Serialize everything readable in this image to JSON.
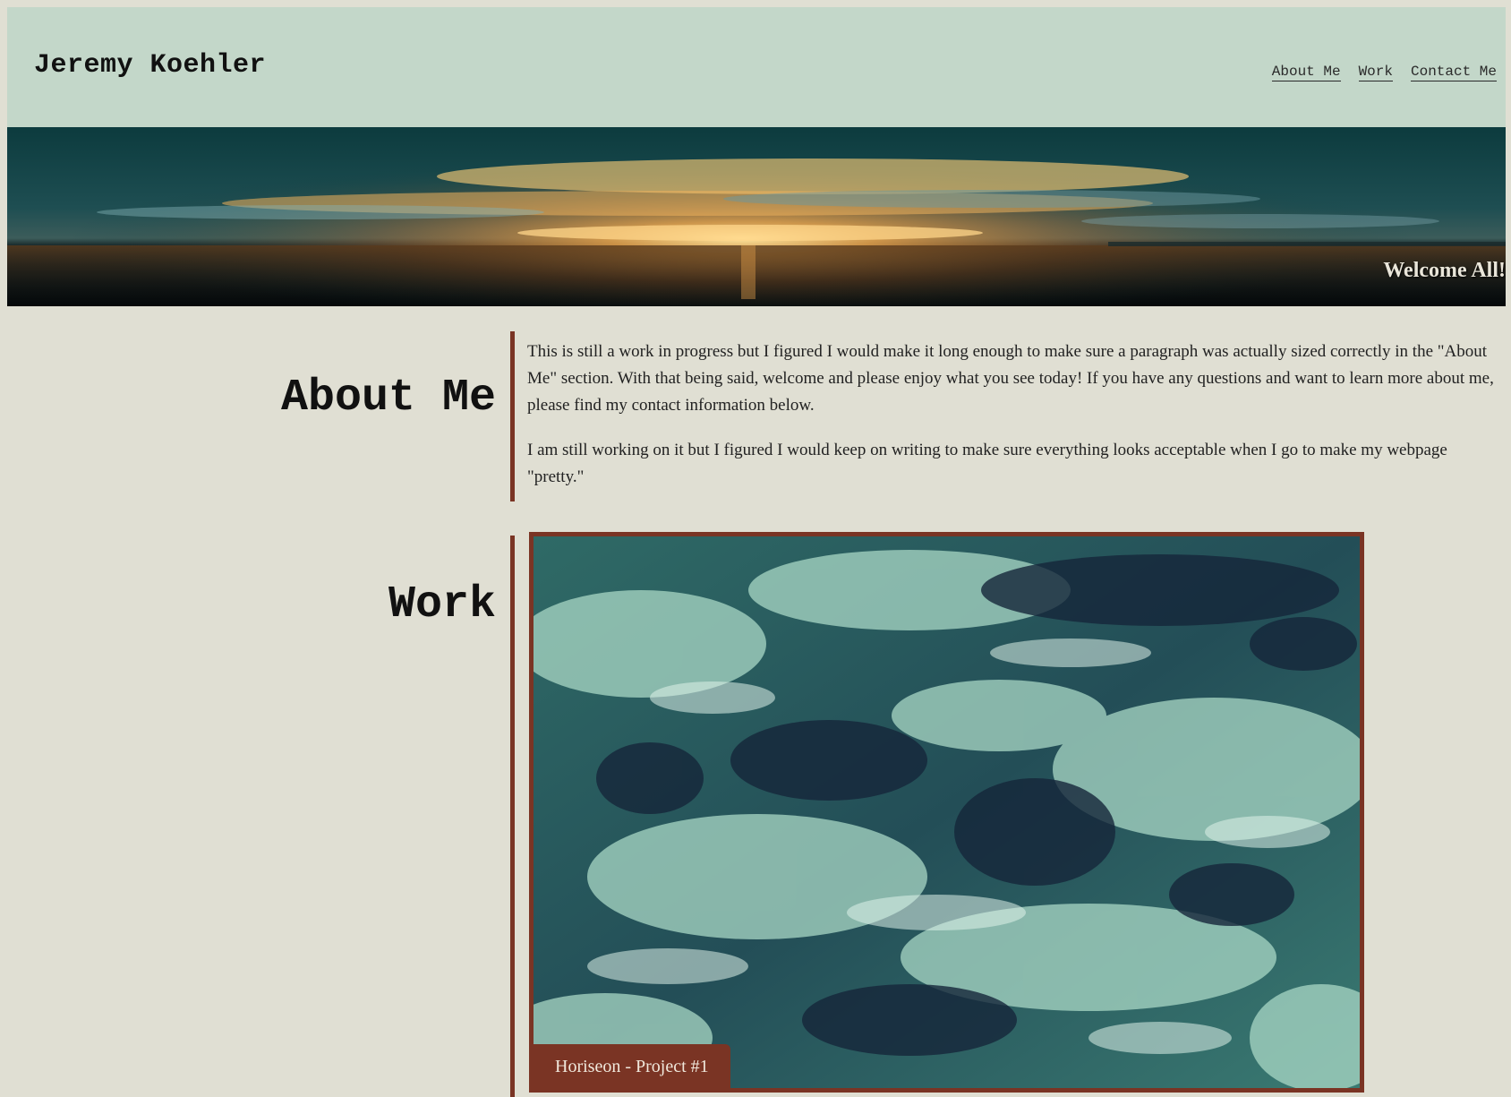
{
  "header": {
    "site_title": "Jeremy Koehler",
    "nav": [
      {
        "label": "About Me"
      },
      {
        "label": "Work"
      },
      {
        "label": "Contact Me"
      }
    ]
  },
  "hero": {
    "tagline": "Welcome All!"
  },
  "about": {
    "heading": "About Me",
    "paragraphs": [
      "This is still a work in progress but I figured I would make it long enough to make sure a paragraph was actually sized correctly in the \"About Me\" section. With that being said, welcome and please enjoy what you see today! If you have any questions and want to learn more about me, please find my contact information below.",
      "I am still working on it but I figured I would keep on writing to make sure everything looks acceptable when I go to make my webpage \"pretty.\""
    ]
  },
  "work": {
    "heading": "Work",
    "projects": [
      {
        "label": "Horiseon - Project #1"
      }
    ]
  },
  "colors": {
    "header_bg": "#c3d7c9",
    "page_bg": "#e0dfd3",
    "accent": "#7a3424"
  }
}
